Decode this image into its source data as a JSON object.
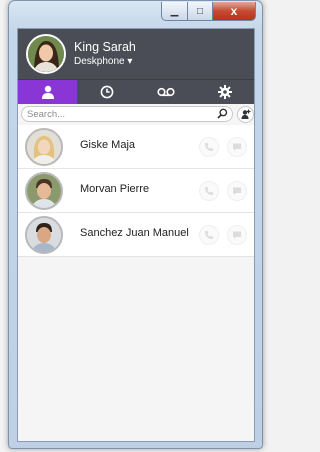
{
  "window": {
    "caption_buttons": {
      "minimize": "▁",
      "maximize": "□",
      "close": "x"
    }
  },
  "user": {
    "name": "King Sarah",
    "device": "Deskphone ▾",
    "presence_color": "#ffffff"
  },
  "tabs": [
    {
      "icon": "contacts-icon",
      "active": true
    },
    {
      "icon": "history-clock-icon",
      "active": false
    },
    {
      "icon": "voicemail-icon",
      "active": false
    },
    {
      "icon": "settings-gear-icon",
      "active": false
    }
  ],
  "search": {
    "placeholder": "Search..."
  },
  "contacts": [
    {
      "name": "Giske Maja"
    },
    {
      "name": "Morvan Pierre"
    },
    {
      "name": "Sanchez Juan Manuel"
    }
  ],
  "colors": {
    "accent": "#8a36d6",
    "header_bg": "#4a4d55",
    "list_bg": "#f5f5f5",
    "icon_inactive": "#dcdcdc"
  }
}
